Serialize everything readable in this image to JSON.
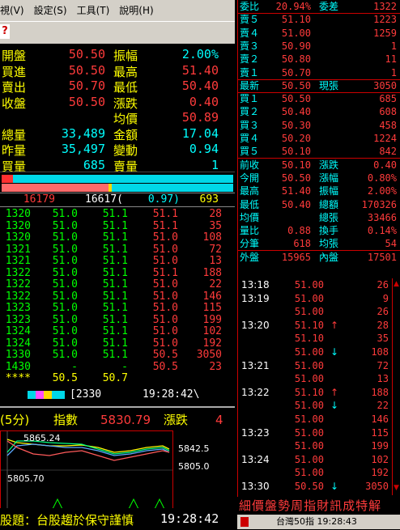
{
  "menu": [
    "視(V)",
    "設定(S)",
    "工具(T)",
    "說明(H)"
  ],
  "quote": {
    "rows": [
      {
        "l": "開盤",
        "lc": "y",
        "v": "50.50",
        "vc": "r",
        "l2": "振幅",
        "l2c": "y",
        "v2": "2.00%",
        "v2c": "c"
      },
      {
        "l": "買進",
        "lc": "y",
        "v": "50.50",
        "vc": "r",
        "l2": "最高",
        "l2c": "y",
        "v2": "51.40",
        "v2c": "r"
      },
      {
        "l": "賣出",
        "lc": "y",
        "v": "50.70",
        "vc": "r",
        "l2": "最低",
        "l2c": "y",
        "v2": "50.40",
        "v2c": "r"
      },
      {
        "l": "收盤",
        "lc": "y",
        "v": "50.50",
        "vc": "r",
        "l2": "漲跌",
        "l2c": "y",
        "v2": "0.40",
        "v2c": "r"
      },
      {
        "l": "",
        "lc": "y",
        "v": "",
        "vc": "r",
        "l2": "均價",
        "l2c": "y",
        "v2": "50.89",
        "v2c": "r"
      },
      {
        "l": "總量",
        "lc": "y",
        "v": "33,489",
        "vc": "c",
        "l2": "金額",
        "l2c": "y",
        "v2": "17.04",
        "v2c": "c"
      },
      {
        "l": "昨量",
        "lc": "y",
        "v": "35,497",
        "vc": "c",
        "l2": "變動",
        "l2c": "y",
        "v2": "0.94",
        "v2c": "c"
      },
      {
        "l": "買量",
        "lc": "y",
        "v": "685",
        "vc": "c",
        "l2": "賣量",
        "l2c": "y",
        "v2": "1",
        "v2c": "c"
      }
    ]
  },
  "summary": {
    "a": "16179",
    "b": "16617(",
    "c": "0.97)",
    "d": "693"
  },
  "ticks": [
    [
      "1320",
      "51.0",
      "51.1",
      "51.1",
      "28"
    ],
    [
      "1320",
      "51.0",
      "51.1",
      "51.1",
      "35"
    ],
    [
      "1320",
      "51.0",
      "51.1",
      "51.0",
      "108"
    ],
    [
      "1321",
      "51.0",
      "51.1",
      "51.0",
      "72"
    ],
    [
      "1321",
      "51.0",
      "51.1",
      "51.0",
      "13"
    ],
    [
      "1322",
      "51.0",
      "51.1",
      "51.1",
      "188"
    ],
    [
      "1322",
      "51.0",
      "51.1",
      "51.0",
      "22"
    ],
    [
      "1322",
      "51.0",
      "51.1",
      "51.0",
      "146"
    ],
    [
      "1323",
      "51.0",
      "51.1",
      "51.0",
      "115"
    ],
    [
      "1323",
      "51.0",
      "51.1",
      "51.0",
      "199"
    ],
    [
      "1324",
      "51.0",
      "51.1",
      "51.0",
      "102"
    ],
    [
      "1324",
      "51.0",
      "51.1",
      "51.0",
      "192"
    ],
    [
      "1330",
      "51.0",
      "51.1",
      "50.5",
      "3050"
    ],
    [
      "1430",
      "-",
      "-",
      "50.5",
      "23"
    ],
    [
      "****",
      "50.5",
      "50.7",
      "",
      ""
    ]
  ],
  "statusline": {
    "code": "[2330",
    "time": "19:28:42\\"
  },
  "indexBar": {
    "label1": "(5分)",
    "label2": "指數",
    "value": "5830.79",
    "label3": "漲跌",
    "value2": "4"
  },
  "indexChart": {
    "top": "5865.24",
    "mid": "5805.70",
    "right1": "5842.5",
    "right2": "5805.0",
    "zero": "0"
  },
  "ticker": {
    "text": "股題：台股趨於保守謹慎",
    "time": "19:28:42"
  },
  "right": {
    "top": [
      {
        "a": "委比",
        "b": "20.94%",
        "c": "委差",
        "d": "1322"
      },
      {
        "a": "賣５",
        "b": "51.10",
        "c": "",
        "d": "1223"
      },
      {
        "a": "賣４",
        "b": "51.00",
        "c": "",
        "d": "1259"
      },
      {
        "a": "賣３",
        "b": "50.90",
        "c": "",
        "d": "1"
      },
      {
        "a": "賣２",
        "b": "50.80",
        "c": "",
        "d": "11"
      },
      {
        "a": "賣１",
        "b": "50.70",
        "c": "",
        "d": "1"
      },
      {
        "a": "最新",
        "b": "50.50",
        "c": "現張",
        "d": "3050"
      },
      {
        "a": "買１",
        "b": "50.50",
        "c": "",
        "d": "685"
      },
      {
        "a": "買２",
        "b": "50.40",
        "c": "",
        "d": "608"
      },
      {
        "a": "買３",
        "b": "50.30",
        "c": "",
        "d": "458"
      },
      {
        "a": "買４",
        "b": "50.20",
        "c": "",
        "d": "1224"
      },
      {
        "a": "買５",
        "b": "50.10",
        "c": "",
        "d": "842"
      },
      {
        "a": "前收",
        "b": "50.10",
        "c": "漲跌",
        "d": "0.40"
      },
      {
        "a": "今開",
        "b": "50.50",
        "c": "漲幅",
        "d": "0.80%"
      },
      {
        "a": "最高",
        "b": "51.40",
        "c": "振幅",
        "d": "2.00%"
      },
      {
        "a": "最低",
        "b": "50.40",
        "c": "總額",
        "d": "170326"
      },
      {
        "a": "均價",
        "b": "",
        "c": "總張",
        "d": "33466"
      },
      {
        "a": "量比",
        "b": "0.88",
        "c": "換手",
        "d": "0.14%"
      },
      {
        "a": "分筆",
        "b": "618",
        "c": "均張",
        "d": "54"
      },
      {
        "a": "外盤",
        "b": "15965",
        "c": "內盤",
        "d": "17501"
      }
    ],
    "ticks": [
      {
        "t": "13:18",
        "p": "51.00",
        "ar": "",
        "v": "26"
      },
      {
        "t": "13:19",
        "p": "51.00",
        "ar": "",
        "v": "9"
      },
      {
        "t": "",
        "p": "51.00",
        "ar": "",
        "v": "26"
      },
      {
        "t": "13:20",
        "p": "51.10",
        "ar": "↑",
        "v": "28"
      },
      {
        "t": "",
        "p": "51.10",
        "ar": "",
        "v": "35"
      },
      {
        "t": "",
        "p": "51.00",
        "ar": "↓",
        "v": "108"
      },
      {
        "t": "13:21",
        "p": "51.00",
        "ar": "",
        "v": "72"
      },
      {
        "t": "",
        "p": "51.00",
        "ar": "",
        "v": "13"
      },
      {
        "t": "13:22",
        "p": "51.10",
        "ar": "↑",
        "v": "188"
      },
      {
        "t": "",
        "p": "51.00",
        "ar": "↓",
        "v": "22"
      },
      {
        "t": "",
        "p": "51.00",
        "ar": "",
        "v": "146"
      },
      {
        "t": "13:23",
        "p": "51.00",
        "ar": "",
        "v": "115"
      },
      {
        "t": "",
        "p": "51.00",
        "ar": "",
        "v": "199"
      },
      {
        "t": "13:24",
        "p": "51.00",
        "ar": "",
        "v": "102"
      },
      {
        "t": "",
        "p": "51.00",
        "ar": "",
        "v": "192"
      },
      {
        "t": "13:30",
        "p": "50.50",
        "ar": "↓",
        "v": "3050"
      }
    ],
    "tabs": "細價盤勢周指財訊成特解",
    "status": "台灣50指 19:28:43"
  }
}
